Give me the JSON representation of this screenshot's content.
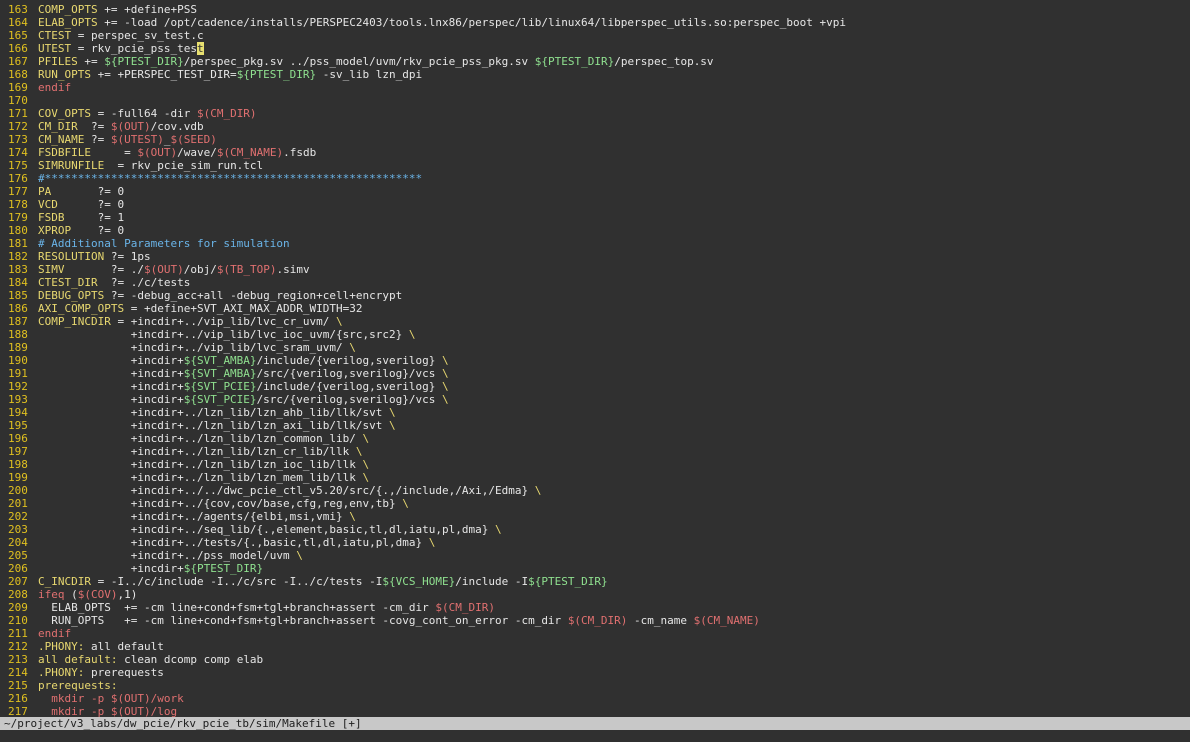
{
  "editor": {
    "lines": [
      {
        "n": "163",
        "segs": [
          {
            "t": "COMP_OPTS",
            "c": "var"
          },
          {
            "t": " += +define+PSS"
          }
        ]
      },
      {
        "n": "164",
        "segs": [
          {
            "t": "ELAB_OPTS",
            "c": "var"
          },
          {
            "t": " += -load /opt/cadence/installs/PERSPEC2403/tools.lnx86/perspec/lib/linux64/libperspec_utils.so:perspec_boot +vpi"
          }
        ]
      },
      {
        "n": "165",
        "segs": [
          {
            "t": "CTEST",
            "c": "var"
          },
          {
            "t": " = perspec_sv_test.c"
          }
        ]
      },
      {
        "n": "166",
        "segs": [
          {
            "t": "UTEST",
            "c": "var"
          },
          {
            "t": " = rkv_pcie_pss_tes"
          },
          {
            "t": "t",
            "c": "cursor"
          }
        ]
      },
      {
        "n": "167",
        "segs": [
          {
            "t": "PFILES",
            "c": "var"
          },
          {
            "t": " += "
          },
          {
            "t": "${PTEST_DIR}",
            "c": "mac"
          },
          {
            "t": "/perspec_pkg.sv ../pss_model/uvm/rkv_pcie_pss_pkg.sv "
          },
          {
            "t": "${PTEST_DIR}",
            "c": "mac"
          },
          {
            "t": "/perspec_top.sv"
          }
        ]
      },
      {
        "n": "168",
        "segs": [
          {
            "t": "RUN_OPTS",
            "c": "var"
          },
          {
            "t": " += +PERSPEC_TEST_DIR="
          },
          {
            "t": "${PTEST_DIR}",
            "c": "mac"
          },
          {
            "t": " -sv_lib lzn_dpi"
          }
        ]
      },
      {
        "n": "169",
        "segs": [
          {
            "t": "endif",
            "c": "kw"
          }
        ]
      },
      {
        "n": "170",
        "segs": []
      },
      {
        "n": "171",
        "segs": [
          {
            "t": "COV_OPTS",
            "c": "var"
          },
          {
            "t": " = -full64 -dir "
          },
          {
            "t": "$(CM_DIR)",
            "c": "kw"
          }
        ]
      },
      {
        "n": "172",
        "segs": [
          {
            "t": "CM_DIR",
            "c": "var"
          },
          {
            "t": "  ?= "
          },
          {
            "t": "$(OUT)",
            "c": "kw"
          },
          {
            "t": "/cov.vdb"
          }
        ]
      },
      {
        "n": "173",
        "segs": [
          {
            "t": "CM_NAME",
            "c": "var"
          },
          {
            "t": " ?= "
          },
          {
            "t": "$(UTEST)",
            "c": "kw"
          },
          {
            "t": "_"
          },
          {
            "t": "$(SEED)",
            "c": "kw"
          }
        ]
      },
      {
        "n": "174",
        "segs": [
          {
            "t": "FSDBFILE",
            "c": "var"
          },
          {
            "t": "     = "
          },
          {
            "t": "$(OUT)",
            "c": "kw"
          },
          {
            "t": "/wave/"
          },
          {
            "t": "$(CM_NAME)",
            "c": "kw"
          },
          {
            "t": ".fsdb"
          }
        ]
      },
      {
        "n": "175",
        "segs": [
          {
            "t": "SIMRUNFILE",
            "c": "var"
          },
          {
            "t": "  = rkv_pcie_sim_run.tcl"
          }
        ]
      },
      {
        "n": "176",
        "segs": [
          {
            "t": "#*********************************************************",
            "c": "comment"
          }
        ]
      },
      {
        "n": "177",
        "segs": [
          {
            "t": "PA",
            "c": "var"
          },
          {
            "t": "       ?= 0"
          }
        ]
      },
      {
        "n": "178",
        "segs": [
          {
            "t": "VCD",
            "c": "var"
          },
          {
            "t": "      ?= 0"
          }
        ]
      },
      {
        "n": "179",
        "segs": [
          {
            "t": "FSDB",
            "c": "var"
          },
          {
            "t": "     ?= 1"
          }
        ]
      },
      {
        "n": "180",
        "segs": [
          {
            "t": "XPROP",
            "c": "var"
          },
          {
            "t": "    ?= 0"
          }
        ]
      },
      {
        "n": "181",
        "segs": [
          {
            "t": "# Additional Parameters for simulation",
            "c": "comment"
          }
        ]
      },
      {
        "n": "182",
        "segs": [
          {
            "t": "RESOLUTION",
            "c": "var"
          },
          {
            "t": " ?= 1ps"
          }
        ]
      },
      {
        "n": "183",
        "segs": [
          {
            "t": "SIMV",
            "c": "var"
          },
          {
            "t": "       ?= ./"
          },
          {
            "t": "$(OUT)",
            "c": "kw"
          },
          {
            "t": "/obj/"
          },
          {
            "t": "$(TB_TOP)",
            "c": "kw"
          },
          {
            "t": ".simv"
          }
        ]
      },
      {
        "n": "184",
        "segs": [
          {
            "t": "CTEST_DIR",
            "c": "var"
          },
          {
            "t": "  ?= ./c/tests"
          }
        ]
      },
      {
        "n": "185",
        "segs": [
          {
            "t": "DEBUG_OPTS",
            "c": "var"
          },
          {
            "t": " ?= -debug_acc+all -debug_region+cell+encrypt"
          }
        ]
      },
      {
        "n": "186",
        "segs": [
          {
            "t": "AXI_COMP_OPTS",
            "c": "var"
          },
          {
            "t": " = +define+SVT_AXI_MAX_ADDR_WIDTH=32"
          }
        ]
      },
      {
        "n": "187",
        "segs": [
          {
            "t": "COMP_INCDIR",
            "c": "var"
          },
          {
            "t": " = +incdir+../vip_lib/lvc_cr_uvm/ "
          },
          {
            "t": "\\",
            "c": "var"
          }
        ]
      },
      {
        "n": "188",
        "segs": [
          {
            "t": "              +incdir+../vip_lib/lvc_ioc_uvm/{src,src2} "
          },
          {
            "t": "\\",
            "c": "var"
          }
        ]
      },
      {
        "n": "189",
        "segs": [
          {
            "t": "              +incdir+../vip_lib/lvc_sram_uvm/ "
          },
          {
            "t": "\\",
            "c": "var"
          }
        ]
      },
      {
        "n": "190",
        "segs": [
          {
            "t": "              +incdir+"
          },
          {
            "t": "${SVT_AMBA}",
            "c": "mac"
          },
          {
            "t": "/include/{verilog,sverilog} "
          },
          {
            "t": "\\",
            "c": "var"
          }
        ]
      },
      {
        "n": "191",
        "segs": [
          {
            "t": "              +incdir+"
          },
          {
            "t": "${SVT_AMBA}",
            "c": "mac"
          },
          {
            "t": "/src/{verilog,sverilog}/vcs "
          },
          {
            "t": "\\",
            "c": "var"
          }
        ]
      },
      {
        "n": "192",
        "segs": [
          {
            "t": "              +incdir+"
          },
          {
            "t": "${SVT_PCIE}",
            "c": "mac"
          },
          {
            "t": "/include/{verilog,sverilog} "
          },
          {
            "t": "\\",
            "c": "var"
          }
        ]
      },
      {
        "n": "193",
        "segs": [
          {
            "t": "              +incdir+"
          },
          {
            "t": "${SVT_PCIE}",
            "c": "mac"
          },
          {
            "t": "/src/{verilog,sverilog}/vcs "
          },
          {
            "t": "\\",
            "c": "var"
          }
        ]
      },
      {
        "n": "194",
        "segs": [
          {
            "t": "              +incdir+../lzn_lib/lzn_ahb_lib/llk/svt "
          },
          {
            "t": "\\",
            "c": "var"
          }
        ]
      },
      {
        "n": "195",
        "segs": [
          {
            "t": "              +incdir+../lzn_lib/lzn_axi_lib/llk/svt "
          },
          {
            "t": "\\",
            "c": "var"
          }
        ]
      },
      {
        "n": "196",
        "segs": [
          {
            "t": "              +incdir+../lzn_lib/lzn_common_lib/ "
          },
          {
            "t": "\\",
            "c": "var"
          }
        ]
      },
      {
        "n": "197",
        "segs": [
          {
            "t": "              +incdir+../lzn_lib/lzn_cr_lib/llk "
          },
          {
            "t": "\\",
            "c": "var"
          }
        ]
      },
      {
        "n": "198",
        "segs": [
          {
            "t": "              +incdir+../lzn_lib/lzn_ioc_lib/llk "
          },
          {
            "t": "\\",
            "c": "var"
          }
        ]
      },
      {
        "n": "199",
        "segs": [
          {
            "t": "              +incdir+../lzn_lib/lzn_mem_lib/llk "
          },
          {
            "t": "\\",
            "c": "var"
          }
        ]
      },
      {
        "n": "200",
        "segs": [
          {
            "t": "              +incdir+../../dwc_pcie_ctl_v5.20/src/{.,/include,/Axi,/Edma} "
          },
          {
            "t": "\\",
            "c": "var"
          }
        ]
      },
      {
        "n": "201",
        "segs": [
          {
            "t": "              +incdir+../{cov,cov/base,cfg,reg,env,tb} "
          },
          {
            "t": "\\",
            "c": "var"
          }
        ]
      },
      {
        "n": "202",
        "segs": [
          {
            "t": "              +incdir+../agents/{elbi,msi,vmi} "
          },
          {
            "t": "\\",
            "c": "var"
          }
        ]
      },
      {
        "n": "203",
        "segs": [
          {
            "t": "              +incdir+../seq_lib/{.,element,basic,tl,dl,iatu,pl,dma} "
          },
          {
            "t": "\\",
            "c": "var"
          }
        ]
      },
      {
        "n": "204",
        "segs": [
          {
            "t": "              +incdir+../tests/{.,basic,tl,dl,iatu,pl,dma} "
          },
          {
            "t": "\\",
            "c": "var"
          }
        ]
      },
      {
        "n": "205",
        "segs": [
          {
            "t": "              +incdir+../pss_model/uvm "
          },
          {
            "t": "\\",
            "c": "var"
          }
        ]
      },
      {
        "n": "206",
        "segs": [
          {
            "t": "              +incdir+"
          },
          {
            "t": "${PTEST_DIR}",
            "c": "mac"
          }
        ]
      },
      {
        "n": "207",
        "segs": [
          {
            "t": "C_INCDIR",
            "c": "var"
          },
          {
            "t": " = -I../c/include -I../c/src -I../c/tests -I"
          },
          {
            "t": "${VCS_HOME}",
            "c": "mac"
          },
          {
            "t": "/include -I"
          },
          {
            "t": "${PTEST_DIR}",
            "c": "mac"
          }
        ]
      },
      {
        "n": "208",
        "segs": [
          {
            "t": "ifeq",
            "c": "kw"
          },
          {
            "t": " ("
          },
          {
            "t": "$(COV)",
            "c": "kw"
          },
          {
            "t": ",1)"
          }
        ]
      },
      {
        "n": "209",
        "segs": [
          {
            "t": "  ELAB_OPTS  += -cm line+cond+fsm+tgl+branch+assert -cm_dir "
          },
          {
            "t": "$(CM_DIR)",
            "c": "kw"
          }
        ]
      },
      {
        "n": "210",
        "segs": [
          {
            "t": "  RUN_OPTS   += -cm line+cond+fsm+tgl+branch+assert -covg_cont_on_error -cm_dir "
          },
          {
            "t": "$(CM_DIR)",
            "c": "kw"
          },
          {
            "t": " -cm_name "
          },
          {
            "t": "$(CM_NAME)",
            "c": "kw"
          }
        ]
      },
      {
        "n": "211",
        "segs": [
          {
            "t": "endif",
            "c": "kw"
          }
        ]
      },
      {
        "n": "212",
        "segs": [
          {
            "t": ".PHONY:",
            "c": "var"
          },
          {
            "t": " all default"
          }
        ]
      },
      {
        "n": "213",
        "segs": [
          {
            "t": "all default:",
            "c": "var"
          },
          {
            "t": " clean dcomp comp elab"
          }
        ]
      },
      {
        "n": "214",
        "segs": [
          {
            "t": ".PHONY:",
            "c": "var"
          },
          {
            "t": " prerequests"
          }
        ]
      },
      {
        "n": "215",
        "segs": [
          {
            "t": "prerequests:",
            "c": "var"
          }
        ]
      },
      {
        "n": "216",
        "segs": [
          {
            "t": "  mkdir -p ",
            "c": "kw"
          },
          {
            "t": "$(OUT)",
            "c": "kw"
          },
          {
            "t": "/work",
            "c": "kw"
          }
        ]
      },
      {
        "n": "217",
        "segs": [
          {
            "t": "  mkdir -p ",
            "c": "kw"
          },
          {
            "t": "$(OUT)",
            "c": "kw"
          },
          {
            "t": "/log",
            "c": "kw"
          }
        ]
      }
    ]
  },
  "statusbar": {
    "text": "~/project/v3_labs/dw_pcie/rkv_pcie_tb/sim/Makefile [+]"
  }
}
